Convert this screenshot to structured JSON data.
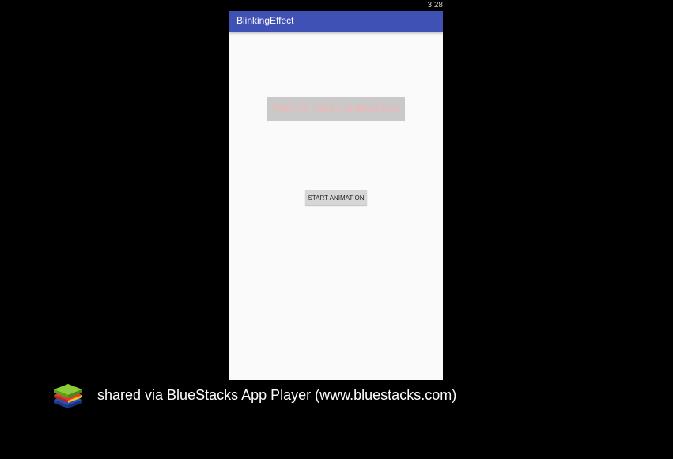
{
  "status_bar": {
    "time": "3:28"
  },
  "app_bar": {
    "title": "BlinkingEffect",
    "color": "#3f51b5"
  },
  "content": {
    "fade_text": "THIS IS FADIN ANIMATION",
    "fade_text_color": "#f4b4b4",
    "start_button_label": "START ANIMATION"
  },
  "footer": {
    "logo_icon": "bluestacks-logo-icon",
    "share_text": "shared via BlueStacks App Player (www.bluestacks.com)"
  }
}
